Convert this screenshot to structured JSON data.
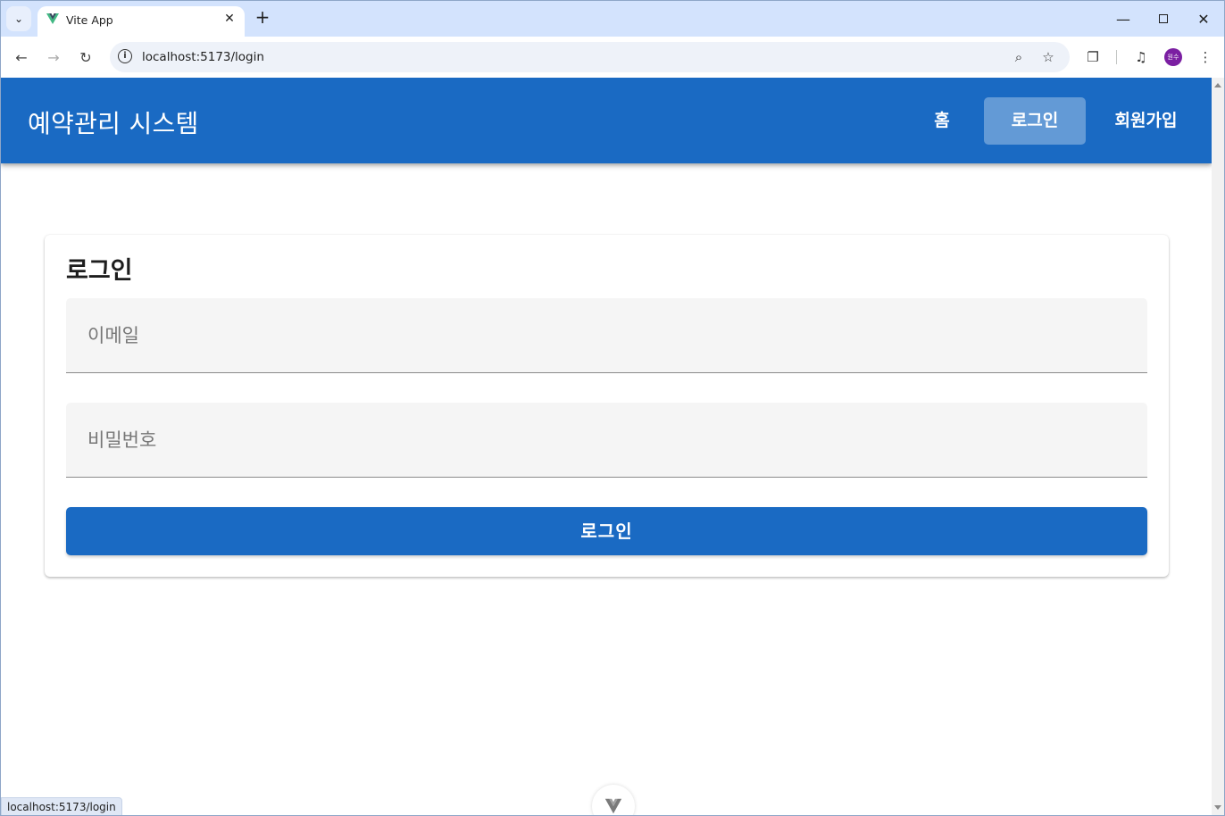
{
  "browser": {
    "tab_title": "Vite App",
    "url": "localhost:5173/login",
    "status_url": "localhost:5173/login",
    "profile_initials": "원수"
  },
  "app": {
    "title": "예약관리 시스템",
    "brand_color": "#1a6ac3",
    "nav": [
      {
        "label": "홈",
        "active": false
      },
      {
        "label": "로그인",
        "active": true
      },
      {
        "label": "회원가입",
        "active": false
      }
    ]
  },
  "login_form": {
    "title": "로그인",
    "email_placeholder": "이메일",
    "password_placeholder": "비밀번호",
    "submit_label": "로그인"
  }
}
